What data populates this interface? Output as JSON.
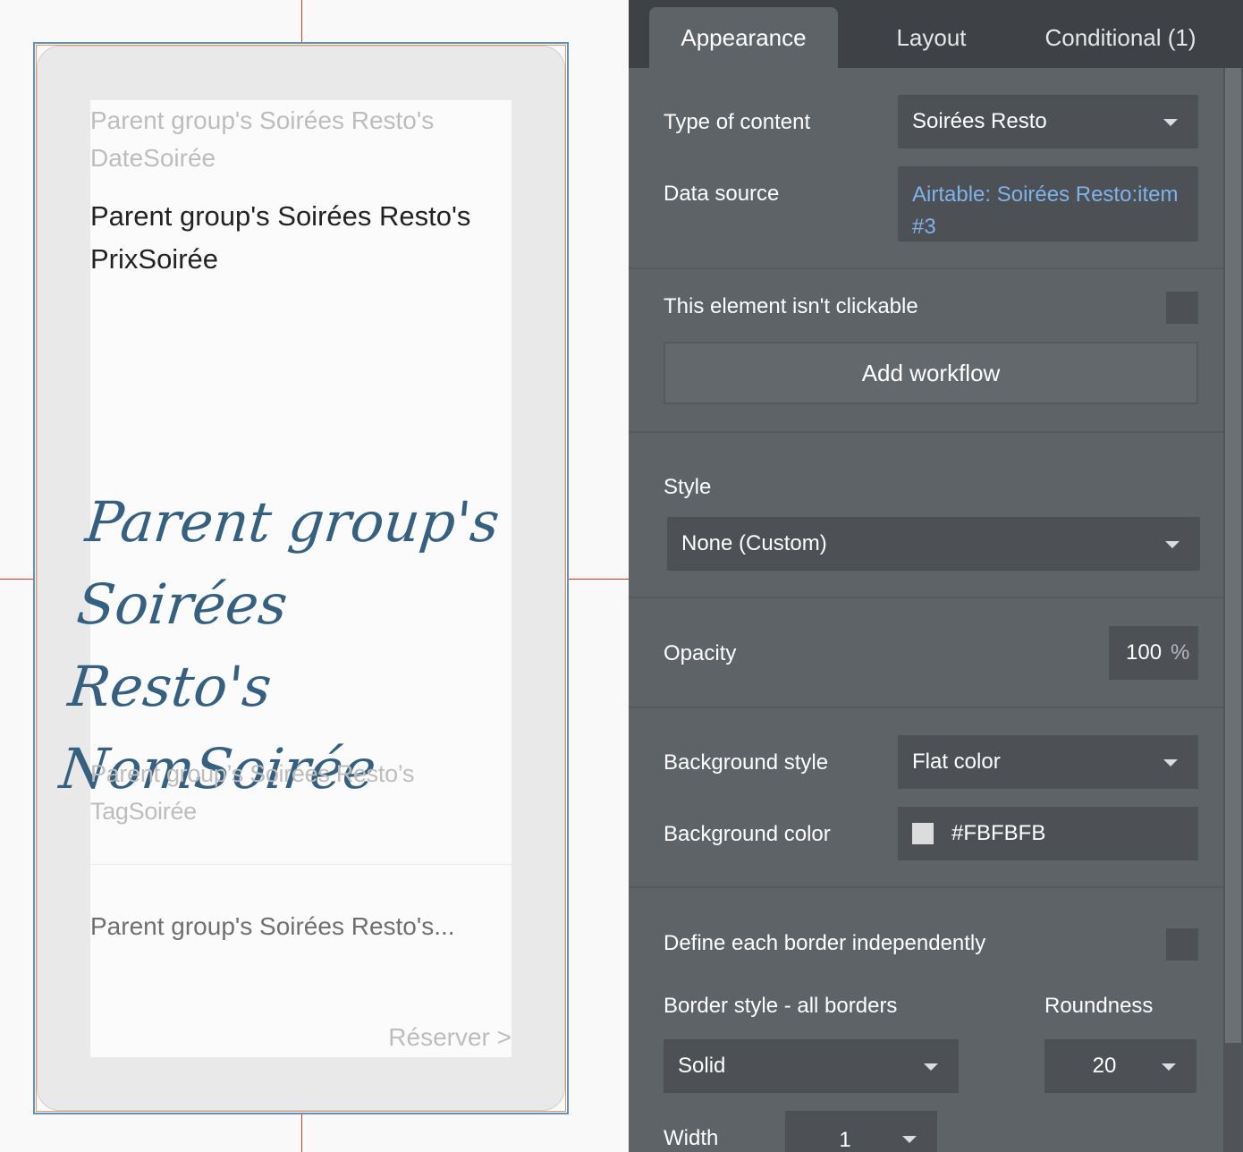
{
  "canvas": {
    "date_text": "Parent group's Soirées Resto's DateSoirée",
    "prix_text": "Parent group's Soirées Resto's PrixSoirée",
    "nom_text": "Parent group's Soirées Resto's NomSoirée",
    "tag_text": "Parent group’s Soirées Resto’s TagSoirée",
    "short_text": "Parent group's Soirées Resto's...",
    "reserver_text": "Réserver >"
  },
  "tabs": [
    "Appearance",
    "Layout",
    "Conditional (1)"
  ],
  "panel": {
    "type_of_content": {
      "label": "Type of content",
      "value": "Soirées Resto"
    },
    "data_source": {
      "label": "Data source",
      "value": "Airtable: Soirées Resto:item #3"
    },
    "not_clickable": {
      "label": "This element isn't clickable",
      "checked": false
    },
    "add_workflow_label": "Add workflow",
    "style": {
      "label": "Style",
      "value": "None (Custom)"
    },
    "opacity": {
      "label": "Opacity",
      "value": "100",
      "unit": "%"
    },
    "background_style": {
      "label": "Background style",
      "value": "Flat color"
    },
    "background_color": {
      "label": "Background color",
      "value": "#FBFBFB"
    },
    "define_each_border": {
      "label": "Define each border independently",
      "checked": false
    },
    "border_style": {
      "label": "Border style - all borders",
      "value": "Solid"
    },
    "roundness": {
      "label": "Roundness",
      "value": "20"
    },
    "width": {
      "label": "Width",
      "value": "1"
    }
  },
  "colors": {
    "panel_bg": "#5e6367",
    "tab_bar_bg": "#3e4246",
    "link": "#7fb2ea",
    "guide_line": "#d9342b",
    "selection_border": "#5f8fc9"
  }
}
